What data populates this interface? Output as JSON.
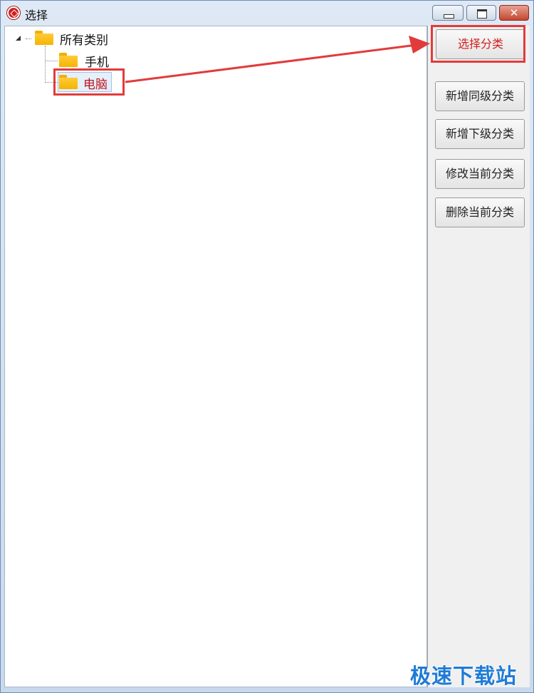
{
  "window": {
    "title": "选择",
    "controls": {
      "minimize": "minimize-icon",
      "maximize": "maximize-icon",
      "close": "close-icon"
    },
    "close_glyph": "✕"
  },
  "tree": {
    "root": {
      "label": "所有类别",
      "icon": "folder-icon",
      "expanded": true
    },
    "children": [
      {
        "label": "手机",
        "icon": "folder-icon",
        "selected": false
      },
      {
        "label": "电脑",
        "icon": "folder-icon",
        "selected": true
      }
    ]
  },
  "actions": {
    "select": "选择分类",
    "add_sibling": "新增同级分类",
    "add_child": "新增下级分类",
    "edit": "修改当前分类",
    "delete": "删除当前分类"
  },
  "annotation": {
    "color": "#e23b3b"
  },
  "watermark": "极速下载站"
}
